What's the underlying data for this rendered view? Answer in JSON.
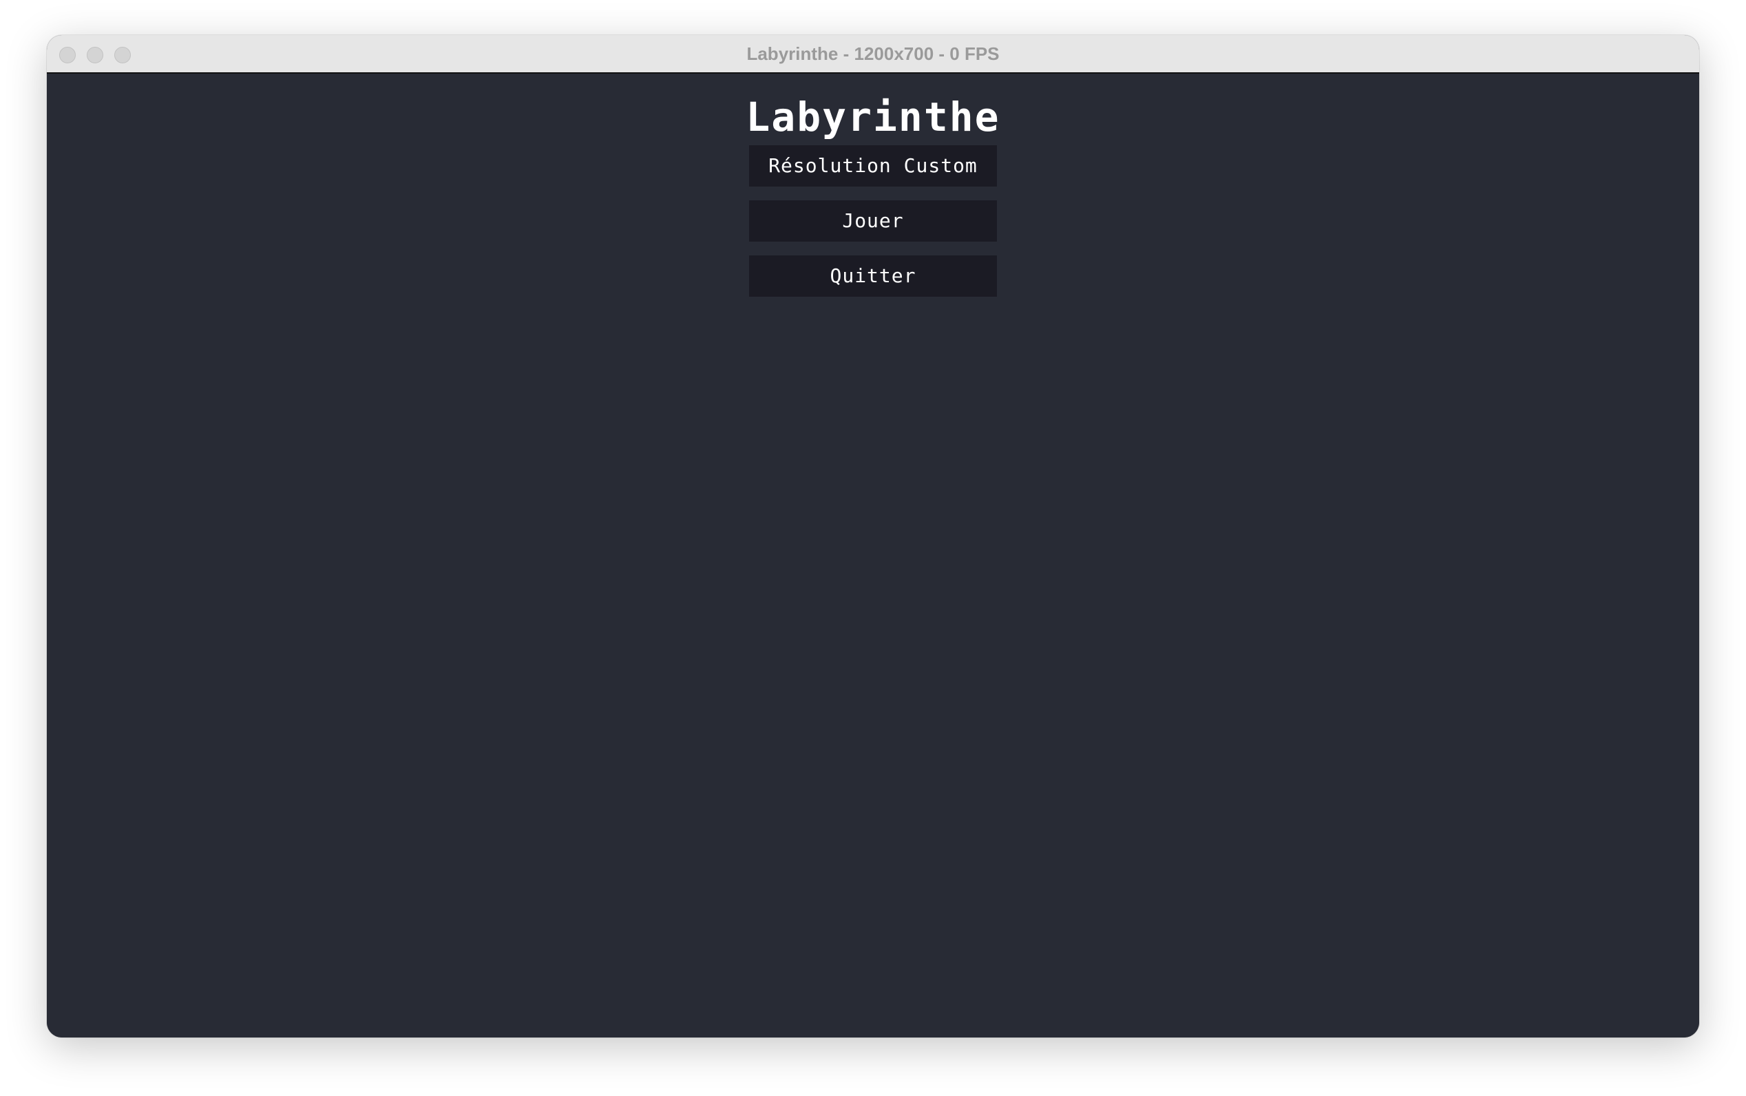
{
  "window": {
    "title": "Labyrinthe - 1200x700 - 0 FPS"
  },
  "menu": {
    "title": "Labyrinthe",
    "buttons": [
      {
        "label": "Résolution Custom"
      },
      {
        "label": "Jouer"
      },
      {
        "label": "Quitter"
      }
    ]
  },
  "colors": {
    "background": "#282b35",
    "button": "#1b1b24",
    "text": "#ffffff",
    "titlebar": "#e6e6e6"
  },
  "icons": {
    "close": "traffic-light-close-icon",
    "minimize": "traffic-light-minimize-icon",
    "zoom": "traffic-light-zoom-icon"
  }
}
